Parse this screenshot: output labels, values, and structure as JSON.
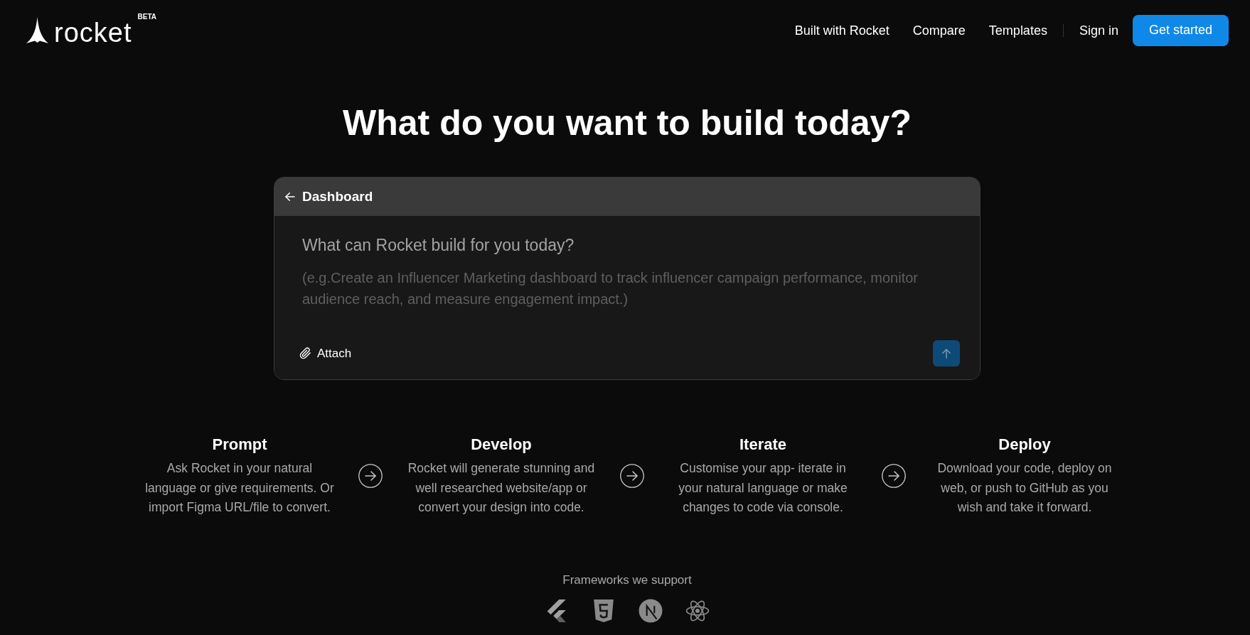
{
  "header": {
    "logo": {
      "wordmark": "rocket",
      "badge": "BETA"
    },
    "links": [
      "Built with Rocket",
      "Compare",
      "Templates"
    ],
    "sign_in": "Sign in",
    "cta": "Get started"
  },
  "hero": {
    "title": "What do you want to build today?"
  },
  "prompt_card": {
    "back_link": "Dashboard",
    "heading": "What can Rocket build for you today?",
    "input": {
      "placeholder": "(e.g.Create an Influencer Marketing dashboard to track influencer campaign performance, monitor audience reach, and measure engagement impact.)"
    },
    "attach": "Attach",
    "send_button": {
      "disabled": true
    }
  },
  "steps": [
    {
      "title": "Prompt",
      "description": "Ask Rocket in your natural language or give requirements. Or import Figma URL/file to convert."
    },
    {
      "title": "Develop",
      "description": "Rocket will generate stunning and well researched website/app or convert your design into code."
    },
    {
      "title": "Iterate",
      "description": "Customise your app- iterate in your natural language or make changes to code via console."
    },
    {
      "title": "Deploy",
      "description": "Download your code, deploy on web, or push to GitHub as you wish and take it forward."
    }
  ],
  "frameworks": {
    "label": "Frameworks we support"
  }
}
